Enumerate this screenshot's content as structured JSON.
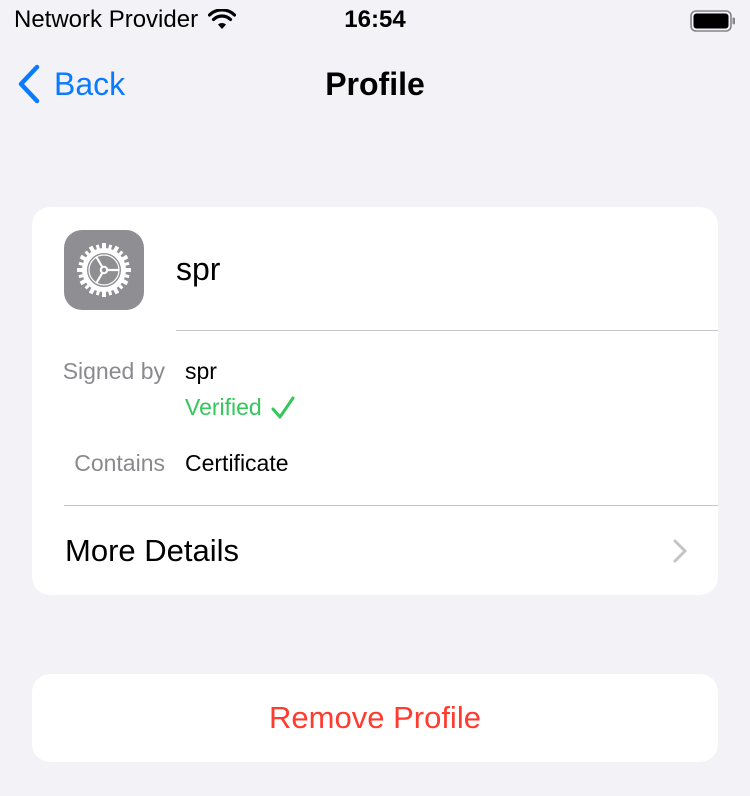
{
  "status_bar": {
    "carrier": "Network Provider",
    "time": "16:54",
    "wifi_icon": "wifi-icon",
    "battery_icon": "battery-icon"
  },
  "nav": {
    "back_label": "Back",
    "title": "Profile"
  },
  "profile": {
    "icon": "settings-gear-icon",
    "name": "spr",
    "signed_by_label": "Signed by",
    "signed_by_value": "spr",
    "verified_label": "Verified",
    "contains_label": "Contains",
    "contains_value": "Certificate",
    "more_details_label": "More Details"
  },
  "actions": {
    "remove_label": "Remove Profile"
  },
  "colors": {
    "accent": "#0a7aff",
    "verified": "#34c759",
    "destructive": "#ff3b30",
    "background": "#f2f2f7"
  }
}
